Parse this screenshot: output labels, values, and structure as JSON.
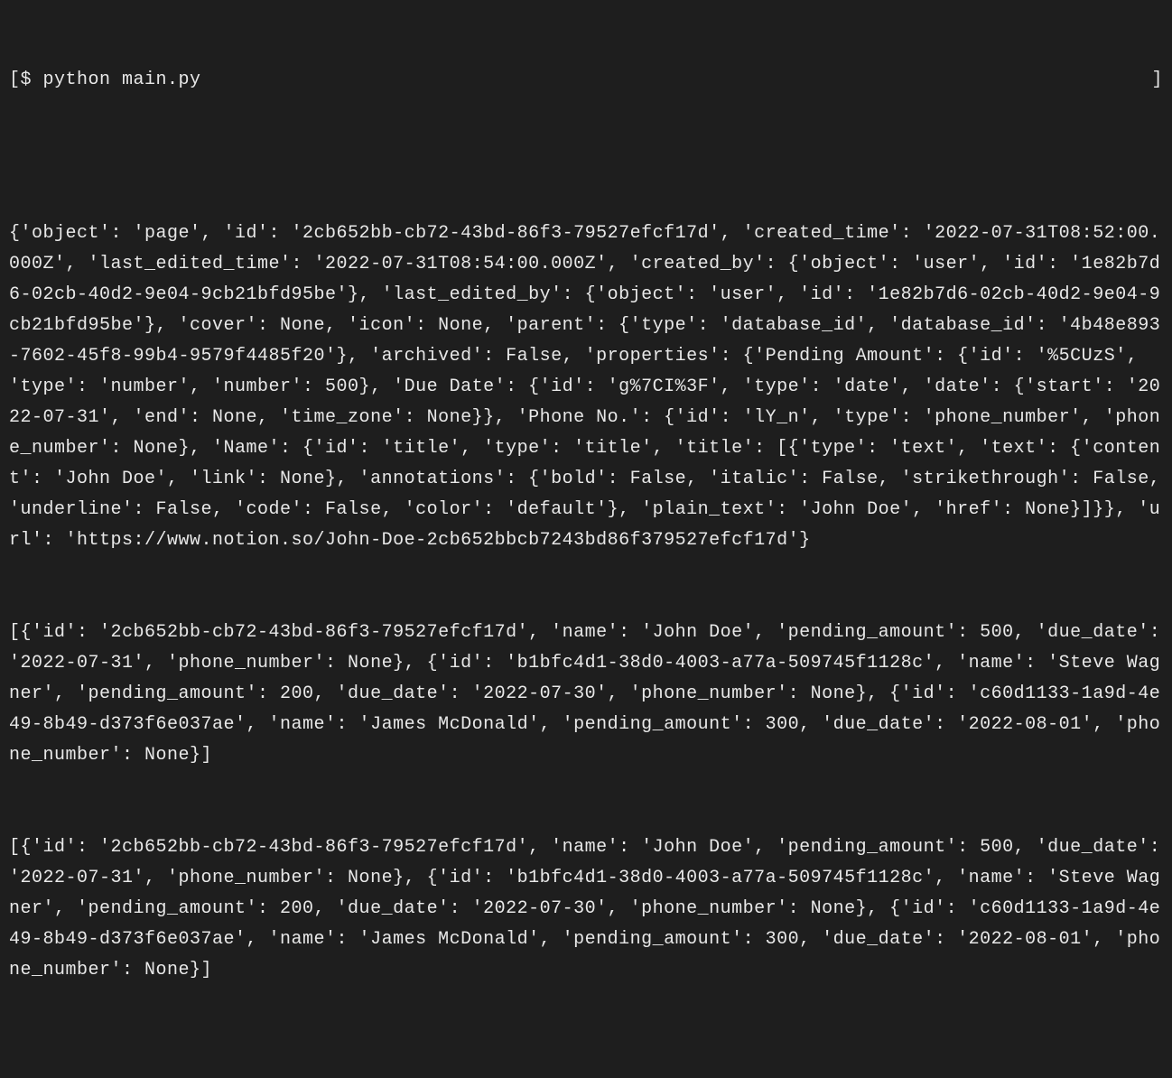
{
  "prompt": {
    "open_bracket": "[",
    "symbol": "$ ",
    "command": "python main.py",
    "close_bracket": "]"
  },
  "output_lines": [
    "{'object': 'page', 'id': '2cb652bb-cb72-43bd-86f3-79527efcf17d', 'created_time': '2022-07-31T08:52:00.000Z', 'last_edited_time': '2022-07-31T08:54:00.000Z', 'created_by': {'object': 'user', 'id': '1e82b7d6-02cb-40d2-9e04-9cb21bfd95be'}, 'last_edited_by': {'object': 'user', 'id': '1e82b7d6-02cb-40d2-9e04-9cb21bfd95be'}, 'cover': None, 'icon': None, 'parent': {'type': 'database_id', 'database_id': '4b48e893-7602-45f8-99b4-9579f4485f20'}, 'archived': False, 'properties': {'Pending Amount': {'id': '%5CUzS', 'type': 'number', 'number': 500}, 'Due Date': {'id': 'g%7CI%3F', 'type': 'date', 'date': {'start': '2022-07-31', 'end': None, 'time_zone': None}}, 'Phone No.': {'id': 'lY_n', 'type': 'phone_number', 'phone_number': None}, 'Name': {'id': 'title', 'type': 'title', 'title': [{'type': 'text', 'text': {'content': 'John Doe', 'link': None}, 'annotations': {'bold': False, 'italic': False, 'strikethrough': False, 'underline': False, 'code': False, 'color': 'default'}, 'plain_text': 'John Doe', 'href': None}]}}, 'url': 'https://www.notion.so/John-Doe-2cb652bbcb7243bd86f379527efcf17d'}",
    "[{'id': '2cb652bb-cb72-43bd-86f3-79527efcf17d', 'name': 'John Doe', 'pending_amount': 500, 'due_date': '2022-07-31', 'phone_number': None}, {'id': 'b1bfc4d1-38d0-4003-a77a-509745f1128c', 'name': 'Steve Wagner', 'pending_amount': 200, 'due_date': '2022-07-30', 'phone_number': None}, {'id': 'c60d1133-1a9d-4e49-8b49-d373f6e037ae', 'name': 'James McDonald', 'pending_amount': 300, 'due_date': '2022-08-01', 'phone_number': None}]",
    "[{'id': '2cb652bb-cb72-43bd-86f3-79527efcf17d', 'name': 'John Doe', 'pending_amount': 500, 'due_date': '2022-07-31', 'phone_number': None}, {'id': 'b1bfc4d1-38d0-4003-a77a-509745f1128c', 'name': 'Steve Wagner', 'pending_amount': 200, 'due_date': '2022-07-30', 'phone_number': None}, {'id': 'c60d1133-1a9d-4e49-8b49-d373f6e037ae', 'name': 'James McDonald', 'pending_amount': 300, 'due_date': '2022-08-01', 'phone_number': None}]"
  ]
}
